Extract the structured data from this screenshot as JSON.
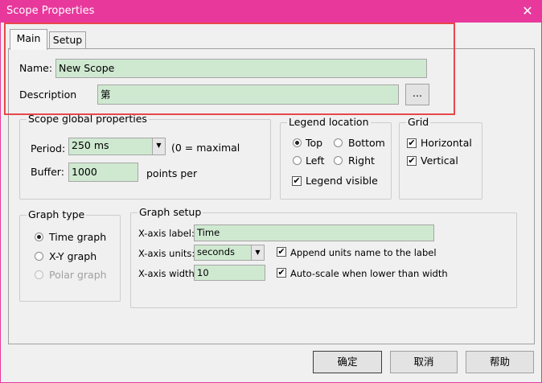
{
  "window": {
    "title": "Scope Properties",
    "close_glyph": "✕"
  },
  "tabs": [
    {
      "label": "Main",
      "active": true
    },
    {
      "label": "Setup",
      "active": false
    }
  ],
  "main": {
    "name_label": "Name:",
    "name_value": "New Scope",
    "description_label": "Description",
    "description_value": "第",
    "browse_label": "..."
  },
  "scope_global": {
    "title": "Scope global properties",
    "period_label": "Period:",
    "period_value": "250 ms",
    "period_note": "(0 = maximal",
    "buffer_label": "Buffer:",
    "buffer_value": "1000",
    "buffer_note": "points per"
  },
  "legend": {
    "title": "Legend location",
    "options": [
      {
        "label": "Top",
        "checked": true
      },
      {
        "label": "Bottom",
        "checked": false
      },
      {
        "label": "Left",
        "checked": false
      },
      {
        "label": "Right",
        "checked": false
      }
    ],
    "visible_label": "Legend visible",
    "visible_checked": true
  },
  "grid": {
    "title": "Grid",
    "options": [
      {
        "label": "Horizontal",
        "checked": true
      },
      {
        "label": "Vertical",
        "checked": true
      }
    ]
  },
  "graph_type": {
    "title": "Graph type",
    "options": [
      {
        "label": "Time graph",
        "checked": true,
        "enabled": true
      },
      {
        "label": "X-Y graph",
        "checked": false,
        "enabled": true
      },
      {
        "label": "Polar graph",
        "checked": false,
        "enabled": false
      }
    ]
  },
  "graph_setup": {
    "title": "Graph setup",
    "xaxis_label_label": "X-axis label:",
    "xaxis_label_value": "Time",
    "xaxis_units_label": "X-axis units:",
    "xaxis_units_value": "seconds",
    "append_units_label": "Append units name to the label",
    "append_units_checked": true,
    "xaxis_width_label": "X-axis width:",
    "xaxis_width_value": "10",
    "autoscale_label": "Auto-scale when lower than width",
    "autoscale_checked": true
  },
  "buttons": {
    "ok": "确定",
    "cancel": "取消",
    "help": "帮助"
  },
  "glyphs": {
    "check": "✔",
    "dropdown": "▼"
  },
  "colors": {
    "accent": "#e8389c",
    "field": "#cfe9d1",
    "highlight": "#e8464a"
  }
}
